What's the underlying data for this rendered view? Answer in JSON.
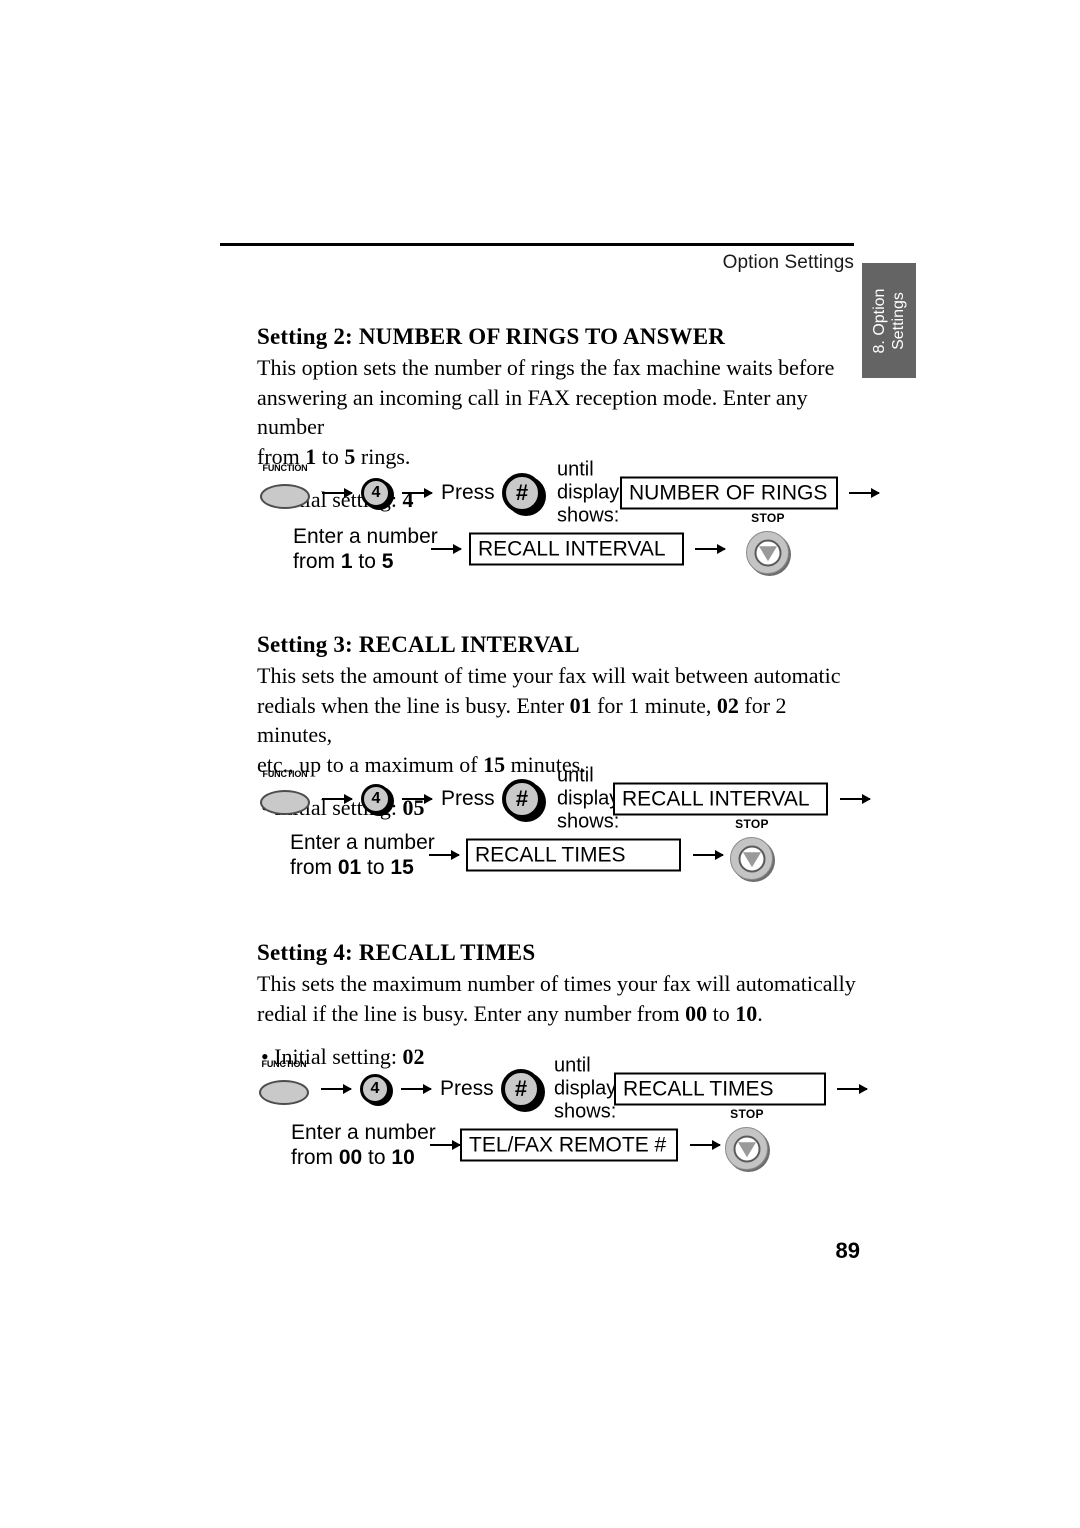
{
  "header": {
    "running_head": "Option Settings",
    "side_tab_line1": "8. Option",
    "side_tab_line2": "Settings"
  },
  "page_number": "89",
  "common": {
    "press_label": "Press",
    "until_line1": "until",
    "until_line2": "display",
    "until_line3": "shows:",
    "function_key_label": "FUNCTION",
    "stop_key_label": "STOP",
    "number_key": "4",
    "hash_key": "#",
    "enter_number_label": "Enter a number"
  },
  "sections": [
    {
      "heading": "Setting 2: NUMBER OF RINGS TO ANSWER",
      "body_line1": "This option sets the number of rings the fax machine waits before",
      "body_line2": "answering an incoming call in FAX reception mode. Enter any number",
      "body_line3_pre": "from ",
      "body_line3_min": "1",
      "body_line3_mid": " to ",
      "body_line3_max": "5",
      "body_line3_post": " rings.",
      "initial_label": "• Initial setting: ",
      "initial_value": "4",
      "display_1": "NUMBER OF RINGS",
      "range_pre": "from ",
      "range_min": "1",
      "range_mid": " to ",
      "range_max": "5",
      "display_2": "RECALL INTERVAL"
    },
    {
      "heading": "Setting 3: RECALL INTERVAL",
      "body_line1": "This sets the amount of time your fax will wait between automatic",
      "body_line2_a": "redials when the line is busy. Enter ",
      "body_line2_b": "01",
      "body_line2_c": " for 1 minute, ",
      "body_line2_d": "02",
      "body_line2_e": " for 2 minutes,",
      "body_line3_a": "etc., up to a maximum of ",
      "body_line3_b": "15",
      "body_line3_c": " minutes.",
      "initial_label": "• Initial setting: ",
      "initial_value": "05",
      "display_1": "RECALL INTERVAL",
      "range_pre": "from ",
      "range_min": "01",
      "range_mid": " to ",
      "range_max": "15",
      "display_2": "RECALL TIMES"
    },
    {
      "heading": "Setting 4: RECALL TIMES",
      "body_line1": "This sets the maximum number of times your fax will automatically",
      "body_line2_a": "redial if the line is busy. Enter any number from ",
      "body_line2_b": "00",
      "body_line2_c": " to ",
      "body_line2_d": "10",
      "body_line2_e": ".",
      "initial_label": "• Initial setting: ",
      "initial_value": "02",
      "display_1": "RECALL TIMES",
      "range_pre": "from ",
      "range_min": "00",
      "range_mid": " to ",
      "range_max": "10",
      "display_2": "TEL/FAX REMOTE #"
    }
  ]
}
